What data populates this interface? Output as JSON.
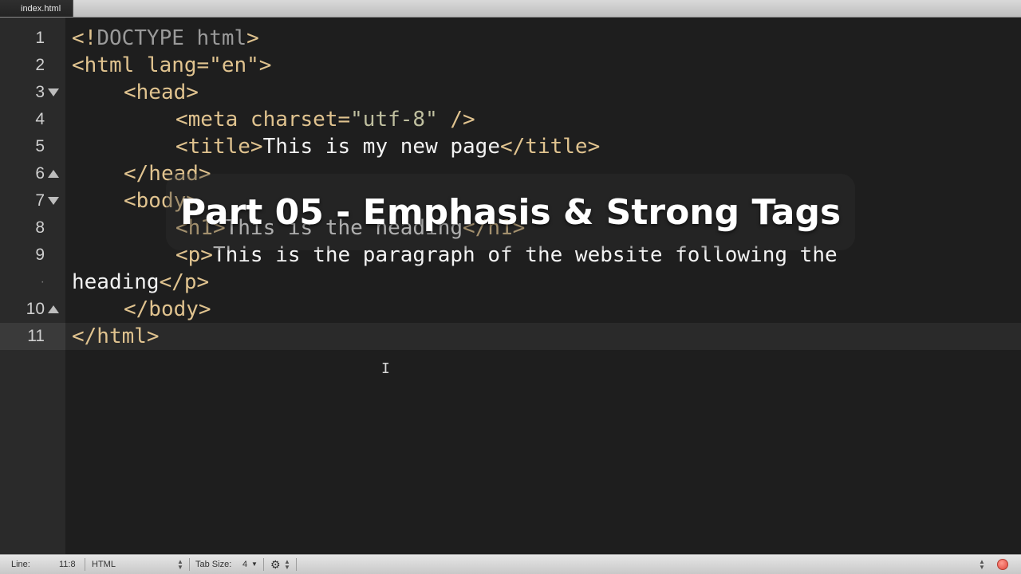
{
  "tab": {
    "label": "index.html"
  },
  "gutter": {
    "rows": [
      {
        "label": "1",
        "fold": ""
      },
      {
        "label": "2",
        "fold": ""
      },
      {
        "label": "3",
        "fold": "down"
      },
      {
        "label": "4",
        "fold": ""
      },
      {
        "label": "5",
        "fold": ""
      },
      {
        "label": "6",
        "fold": "up"
      },
      {
        "label": "7",
        "fold": "down"
      },
      {
        "label": "8",
        "fold": ""
      },
      {
        "label": "9",
        "fold": ""
      },
      {
        "label": "·",
        "fold": ""
      },
      {
        "label": "10",
        "fold": "up"
      },
      {
        "label": "11",
        "fold": ""
      }
    ]
  },
  "code": {
    "l1": {
      "a": "<!",
      "b": "DOCTYPE html",
      "c": ">"
    },
    "l2": {
      "a": "<html lang=\"en\">"
    },
    "l3": {
      "a": "<head>"
    },
    "l4": {
      "a": "<meta charset=",
      "b": "\"utf-8\"",
      "c": " />"
    },
    "l5": {
      "a": "<title>",
      "b": "This is my new page",
      "c": "</title>"
    },
    "l6": {
      "a": "</head>"
    },
    "l7": {
      "a": "<body>"
    },
    "l8": {
      "a": "<h1>",
      "b": "This is the heading",
      "c": "</h1>"
    },
    "l9": {
      "a": "<p>",
      "b": "This is the paragraph of the website following the"
    },
    "l9b": {
      "a": "heading",
      "b": "</p>"
    },
    "l10": {
      "a": "</body>"
    },
    "l11": {
      "a": "</html>"
    }
  },
  "overlay": {
    "title": "Part 05 - Emphasis & Strong Tags"
  },
  "cursor": {
    "glyph": "I"
  },
  "status": {
    "line_label": "Line:",
    "line_value": "11:8",
    "syntax": "HTML",
    "tab_size_label": "Tab Size:",
    "tab_size_value": "4",
    "gear_glyph": "⚙"
  }
}
